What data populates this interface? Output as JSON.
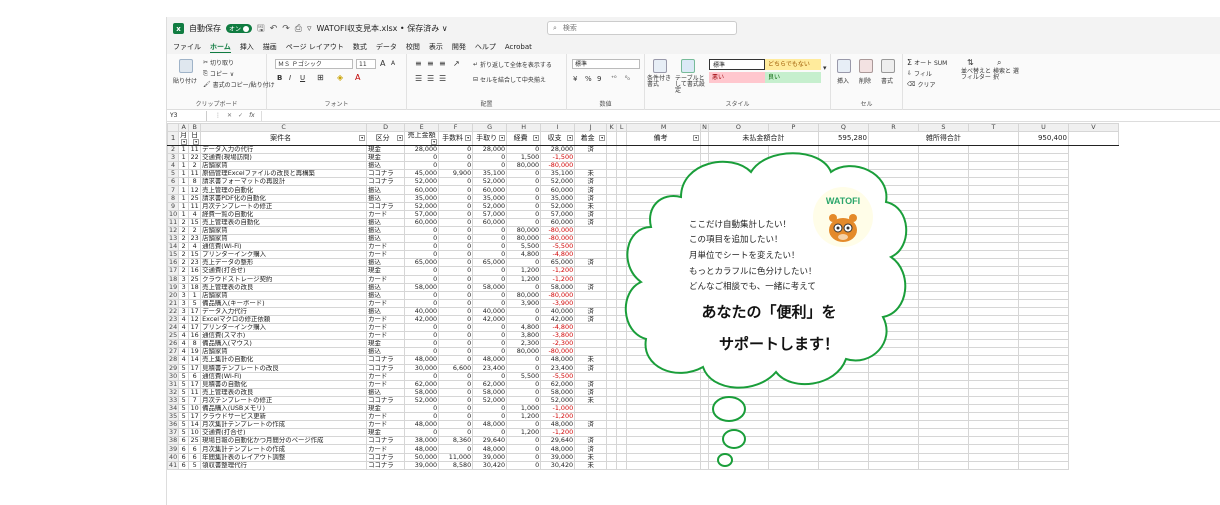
{
  "titlebar": {
    "autosave_label": "自動保存",
    "autosave_state": "オン",
    "filename": "WATOFI収支見本.xlsx • 保存済み ∨",
    "search_placeholder": "検索"
  },
  "tabs": [
    "ファイル",
    "ホーム",
    "挿入",
    "描画",
    "ページ レイアウト",
    "数式",
    "データ",
    "校閲",
    "表示",
    "開発",
    "ヘルプ",
    "Acrobat"
  ],
  "ribbon": {
    "clipboard": {
      "paste": "貼り付け",
      "cut": "切り取り",
      "copy": "コピー ∨",
      "format_painter": "書式のコピー/貼り付け",
      "label": "クリップボード"
    },
    "font": {
      "name": "ＭＳ Ｐゴシック",
      "size": "11",
      "bold": "B",
      "italic": "I",
      "underline": "U",
      "label": "フォント",
      "a_up": "A",
      "a_down": "A"
    },
    "alignment": {
      "wrap": "折り返して全体を表示する",
      "merge": "セルを結合して中央揃え",
      "label": "配置"
    },
    "number": {
      "format": "標準",
      "label": "数値",
      "pct": "%",
      "comma": "9"
    },
    "styles": {
      "cond": "条件付き書式",
      "table": "テーブルとして書式設定",
      "s1": "標準",
      "s2": "どちらでもない",
      "s3": "悪い",
      "s4": "良い",
      "label": "スタイル"
    },
    "cells": {
      "insert": "挿入",
      "delete": "削除",
      "format": "書式",
      "label": "セル"
    },
    "editing": {
      "autosum": "オート SUM",
      "fill": "フィル",
      "clear": "クリア",
      "sort": "並べ替えと フィルター",
      "find": "検索と 選択",
      "label": "編集"
    }
  },
  "formula_bar": {
    "cell": "Y3",
    "fx": "fx"
  },
  "columns": [
    "A",
    "B",
    "C",
    "D",
    "E",
    "F",
    "G",
    "H",
    "I",
    "J",
    "K",
    "L",
    "M",
    "N",
    "O",
    "P",
    "Q",
    "R",
    "S",
    "T",
    "U",
    "V"
  ],
  "header_row": {
    "a": "月",
    "b": "日",
    "c": "案件名",
    "d": "区分",
    "e": "売上金額",
    "f": "手数料",
    "g": "手取り",
    "h": "経費",
    "i": "収支",
    "j": "着金",
    "m": "備考",
    "o": "未払金額合計",
    "q": "595,280",
    "r": "雑所得合計",
    "u": "950,400"
  },
  "rows": [
    {
      "n": "2",
      "a": "1",
      "b": "11",
      "c": "データ入力の代行",
      "d": "現金",
      "e": "28,000",
      "f": "0",
      "g": "28,000",
      "h": "0",
      "i": "28,000",
      "neg": false,
      "j": "済"
    },
    {
      "n": "3",
      "a": "1",
      "b": "22",
      "c": "交通費(現場訪問)",
      "d": "現金",
      "e": "0",
      "f": "0",
      "g": "0",
      "h": "1,500",
      "i": "-1,500",
      "neg": true,
      "j": ""
    },
    {
      "n": "4",
      "a": "1",
      "b": "2",
      "c": "店舗家賃",
      "d": "振込",
      "e": "0",
      "f": "0",
      "g": "0",
      "h": "80,000",
      "i": "-80,000",
      "neg": true,
      "j": ""
    },
    {
      "n": "5",
      "a": "1",
      "b": "11",
      "c": "原価管理Excelファイルの改良と再構築",
      "d": "ココナラ",
      "e": "45,000",
      "f": "9,900",
      "g": "35,100",
      "h": "0",
      "i": "35,100",
      "neg": false,
      "j": "未"
    },
    {
      "n": "6",
      "a": "1",
      "b": "8",
      "c": "請求書フォーマットの再設計",
      "d": "ココナラ",
      "e": "52,000",
      "f": "0",
      "g": "52,000",
      "h": "0",
      "i": "52,000",
      "neg": false,
      "j": "済"
    },
    {
      "n": "7",
      "a": "1",
      "b": "12",
      "c": "売上管理の自動化",
      "d": "振込",
      "e": "60,000",
      "f": "0",
      "g": "60,000",
      "h": "0",
      "i": "60,000",
      "neg": false,
      "j": "済"
    },
    {
      "n": "8",
      "a": "1",
      "b": "25",
      "c": "請求書PDF化の自動化",
      "d": "振込",
      "e": "35,000",
      "f": "0",
      "g": "35,000",
      "h": "0",
      "i": "35,000",
      "neg": false,
      "j": "済"
    },
    {
      "n": "9",
      "a": "1",
      "b": "11",
      "c": "月次テンプレートの修正",
      "d": "ココナラ",
      "e": "52,000",
      "f": "0",
      "g": "52,000",
      "h": "0",
      "i": "52,000",
      "neg": false,
      "j": "未"
    },
    {
      "n": "10",
      "a": "1",
      "b": "4",
      "c": "経費一覧の自動化",
      "d": "カード",
      "e": "57,000",
      "f": "0",
      "g": "57,000",
      "h": "0",
      "i": "57,000",
      "neg": false,
      "j": "済"
    },
    {
      "n": "11",
      "a": "2",
      "b": "15",
      "c": "売上管理表の自動化",
      "d": "振込",
      "e": "60,000",
      "f": "0",
      "g": "60,000",
      "h": "0",
      "i": "60,000",
      "neg": false,
      "j": "済"
    },
    {
      "n": "12",
      "a": "2",
      "b": "2",
      "c": "店舗家賃",
      "d": "振込",
      "e": "0",
      "f": "0",
      "g": "0",
      "h": "80,000",
      "i": "-80,000",
      "neg": true,
      "j": ""
    },
    {
      "n": "13",
      "a": "2",
      "b": "23",
      "c": "店舗家賃",
      "d": "振込",
      "e": "0",
      "f": "0",
      "g": "0",
      "h": "80,000",
      "i": "-80,000",
      "neg": true,
      "j": ""
    },
    {
      "n": "14",
      "a": "2",
      "b": "4",
      "c": "通信費(Wi-Fi)",
      "d": "カード",
      "e": "0",
      "f": "0",
      "g": "0",
      "h": "5,500",
      "i": "-5,500",
      "neg": true,
      "j": ""
    },
    {
      "n": "15",
      "a": "2",
      "b": "15",
      "c": "プリンターインク購入",
      "d": "カード",
      "e": "0",
      "f": "0",
      "g": "0",
      "h": "4,800",
      "i": "-4,800",
      "neg": true,
      "j": ""
    },
    {
      "n": "16",
      "a": "2",
      "b": "23",
      "c": "売上データの整形",
      "d": "振込",
      "e": "65,000",
      "f": "0",
      "g": "65,000",
      "h": "0",
      "i": "65,000",
      "neg": false,
      "j": "済"
    },
    {
      "n": "17",
      "a": "2",
      "b": "16",
      "c": "交通費(打合せ)",
      "d": "現金",
      "e": "0",
      "f": "0",
      "g": "0",
      "h": "1,200",
      "i": "-1,200",
      "neg": true,
      "j": ""
    },
    {
      "n": "18",
      "a": "3",
      "b": "25",
      "c": "クラウドストレージ契約",
      "d": "カード",
      "e": "0",
      "f": "0",
      "g": "0",
      "h": "1,200",
      "i": "-1,200",
      "neg": true,
      "j": ""
    },
    {
      "n": "19",
      "a": "3",
      "b": "18",
      "c": "売上管理表の改良",
      "d": "振込",
      "e": "58,000",
      "f": "0",
      "g": "58,000",
      "h": "0",
      "i": "58,000",
      "neg": false,
      "j": "済"
    },
    {
      "n": "20",
      "a": "3",
      "b": "1",
      "c": "店舗家賃",
      "d": "振込",
      "e": "0",
      "f": "0",
      "g": "0",
      "h": "80,000",
      "i": "-80,000",
      "neg": true,
      "j": ""
    },
    {
      "n": "21",
      "a": "3",
      "b": "5",
      "c": "備品購入(キーボード)",
      "d": "カード",
      "e": "0",
      "f": "0",
      "g": "0",
      "h": "3,900",
      "i": "-3,900",
      "neg": true,
      "j": ""
    },
    {
      "n": "22",
      "a": "3",
      "b": "17",
      "c": "データ入力代行",
      "d": "振込",
      "e": "40,000",
      "f": "0",
      "g": "40,000",
      "h": "0",
      "i": "40,000",
      "neg": false,
      "j": "済"
    },
    {
      "n": "23",
      "a": "4",
      "b": "12",
      "c": "Excelマクロの修正依頼",
      "d": "カード",
      "e": "42,000",
      "f": "0",
      "g": "42,000",
      "h": "0",
      "i": "42,000",
      "neg": false,
      "j": "済"
    },
    {
      "n": "24",
      "a": "4",
      "b": "17",
      "c": "プリンターインク購入",
      "d": "カード",
      "e": "0",
      "f": "0",
      "g": "0",
      "h": "4,800",
      "i": "-4,800",
      "neg": true,
      "j": ""
    },
    {
      "n": "25",
      "a": "4",
      "b": "16",
      "c": "通信費(スマホ)",
      "d": "カード",
      "e": "0",
      "f": "0",
      "g": "0",
      "h": "3,800",
      "i": "-3,800",
      "neg": true,
      "j": ""
    },
    {
      "n": "26",
      "a": "4",
      "b": "8",
      "c": "備品購入(マウス)",
      "d": "現金",
      "e": "0",
      "f": "0",
      "g": "0",
      "h": "2,300",
      "i": "-2,300",
      "neg": true,
      "j": ""
    },
    {
      "n": "27",
      "a": "4",
      "b": "19",
      "c": "店舗家賃",
      "d": "振込",
      "e": "0",
      "f": "0",
      "g": "0",
      "h": "80,000",
      "i": "-80,000",
      "neg": true,
      "j": ""
    },
    {
      "n": "28",
      "a": "4",
      "b": "14",
      "c": "売上集計の自動化",
      "d": "ココナラ",
      "e": "48,000",
      "f": "0",
      "g": "48,000",
      "h": "0",
      "i": "48,000",
      "neg": false,
      "j": "未"
    },
    {
      "n": "29",
      "a": "5",
      "b": "17",
      "c": "見積書テンプレートの改良",
      "d": "ココナラ",
      "e": "30,000",
      "f": "6,600",
      "g": "23,400",
      "h": "0",
      "i": "23,400",
      "neg": false,
      "j": "済"
    },
    {
      "n": "30",
      "a": "5",
      "b": "6",
      "c": "通信費(Wi-Fi)",
      "d": "カード",
      "e": "0",
      "f": "0",
      "g": "0",
      "h": "5,500",
      "i": "-5,500",
      "neg": true,
      "j": ""
    },
    {
      "n": "31",
      "a": "5",
      "b": "17",
      "c": "見積書の自動化",
      "d": "カード",
      "e": "62,000",
      "f": "0",
      "g": "62,000",
      "h": "0",
      "i": "62,000",
      "neg": false,
      "j": "済"
    },
    {
      "n": "32",
      "a": "5",
      "b": "11",
      "c": "売上管理表の改良",
      "d": "振込",
      "e": "58,000",
      "f": "0",
      "g": "58,000",
      "h": "0",
      "i": "58,000",
      "neg": false,
      "j": "済"
    },
    {
      "n": "33",
      "a": "5",
      "b": "7",
      "c": "月次テンプレートの修正",
      "d": "ココナラ",
      "e": "52,000",
      "f": "0",
      "g": "52,000",
      "h": "0",
      "i": "52,000",
      "neg": false,
      "j": "未"
    },
    {
      "n": "34",
      "a": "5",
      "b": "10",
      "c": "備品購入(USBメモリ)",
      "d": "現金",
      "e": "0",
      "f": "0",
      "g": "0",
      "h": "1,000",
      "i": "-1,000",
      "neg": true,
      "j": ""
    },
    {
      "n": "35",
      "a": "5",
      "b": "17",
      "c": "クラウドサービス更新",
      "d": "カード",
      "e": "0",
      "f": "0",
      "g": "0",
      "h": "1,200",
      "i": "-1,200",
      "neg": true,
      "j": ""
    },
    {
      "n": "36",
      "a": "5",
      "b": "14",
      "c": "月次集計テンプレートの作成",
      "d": "カード",
      "e": "48,000",
      "f": "0",
      "g": "48,000",
      "h": "0",
      "i": "48,000",
      "neg": false,
      "j": "済"
    },
    {
      "n": "37",
      "a": "5",
      "b": "10",
      "c": "交通費(打合せ)",
      "d": "現金",
      "e": "0",
      "f": "0",
      "g": "0",
      "h": "1,200",
      "i": "-1,200",
      "neg": true,
      "j": ""
    },
    {
      "n": "38",
      "a": "6",
      "b": "25",
      "c": "現場日報の自動化かつ月間分のページ作成",
      "d": "ココナラ",
      "e": "38,000",
      "f": "8,360",
      "g": "29,640",
      "h": "0",
      "i": "29,640",
      "neg": false,
      "j": "済"
    },
    {
      "n": "39",
      "a": "6",
      "b": "6",
      "c": "月次集計テンプレートの作成",
      "d": "カード",
      "e": "48,000",
      "f": "0",
      "g": "48,000",
      "h": "0",
      "i": "48,000",
      "neg": false,
      "j": "済"
    },
    {
      "n": "40",
      "a": "6",
      "b": "6",
      "c": "年間集計表のレイアウト調整",
      "d": "ココナラ",
      "e": "50,000",
      "f": "11,000",
      "g": "39,000",
      "h": "0",
      "i": "39,000",
      "neg": false,
      "j": "未"
    },
    {
      "n": "41",
      "a": "6",
      "b": "5",
      "c": "領収書整理代行",
      "d": "ココナラ",
      "e": "39,000",
      "f": "8,580",
      "g": "30,420",
      "h": "0",
      "i": "30,420",
      "neg": false,
      "j": "未"
    }
  ],
  "promo": {
    "lines": [
      "ここだけ自動集計したい！",
      "この項目を追加したい！",
      "月単位でシートを変えたい！",
      "もっとカラフルに色分けしたい！",
      "どんなご相談でも、一緒に考えて"
    ],
    "headline1": "あなたの「便利」を",
    "headline2": "サポートします！",
    "logo_text": "WATOFI"
  },
  "colors": {
    "excel_green": "#107c41",
    "negative": "#d00000",
    "cloud_stroke": "#1a9e3a",
    "bad_fill": "#ffc7ce",
    "good_fill": "#c6efce",
    "neutral_fill": "#ffeb9c"
  }
}
